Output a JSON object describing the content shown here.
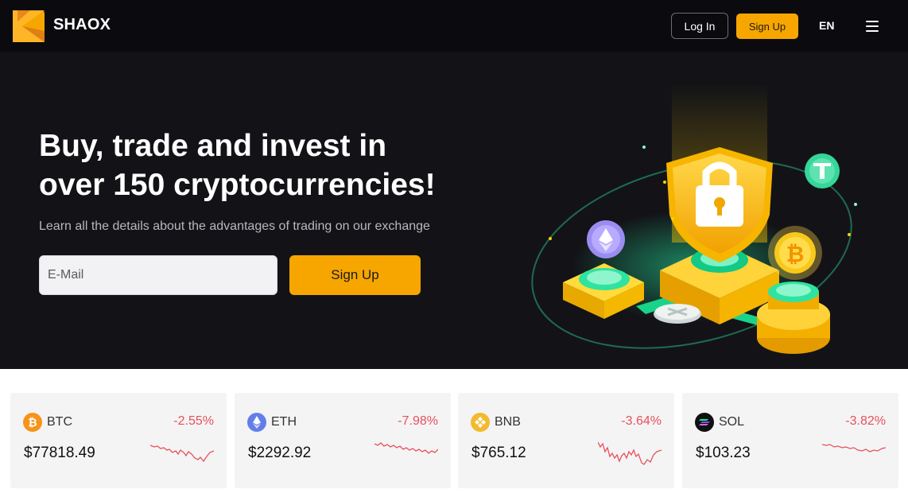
{
  "header": {
    "brand": "SHAOX",
    "login_label": "Log In",
    "signup_label": "Sign Up",
    "language": "EN"
  },
  "hero": {
    "headline_line1": "Buy, trade and invest in",
    "headline_line2": "over 150 cryptocurrencies!",
    "subtitle": "Learn all the details about the advantages of trading on our exchange",
    "email_placeholder": "E-Mail",
    "signup_label": "Sign Up"
  },
  "tickers": [
    {
      "symbol": "BTC",
      "change": "-2.55%",
      "price": "$77818.49",
      "icon": "btc-icon",
      "color": "#f7931a"
    },
    {
      "symbol": "ETH",
      "change": "-7.98%",
      "price": "$2292.92",
      "icon": "eth-icon",
      "color": "#627eea"
    },
    {
      "symbol": "BNB",
      "change": "-3.64%",
      "price": "$765.12",
      "icon": "bnb-icon",
      "color": "#f3ba2f"
    },
    {
      "symbol": "SOL",
      "change": "-3.82%",
      "price": "$103.23",
      "icon": "sol-icon",
      "color": "#111111"
    }
  ],
  "colors": {
    "accent": "#f7a600",
    "negative": "#e8505b",
    "header_bg": "#0b0b0f",
    "hero_bg": "#131317"
  }
}
